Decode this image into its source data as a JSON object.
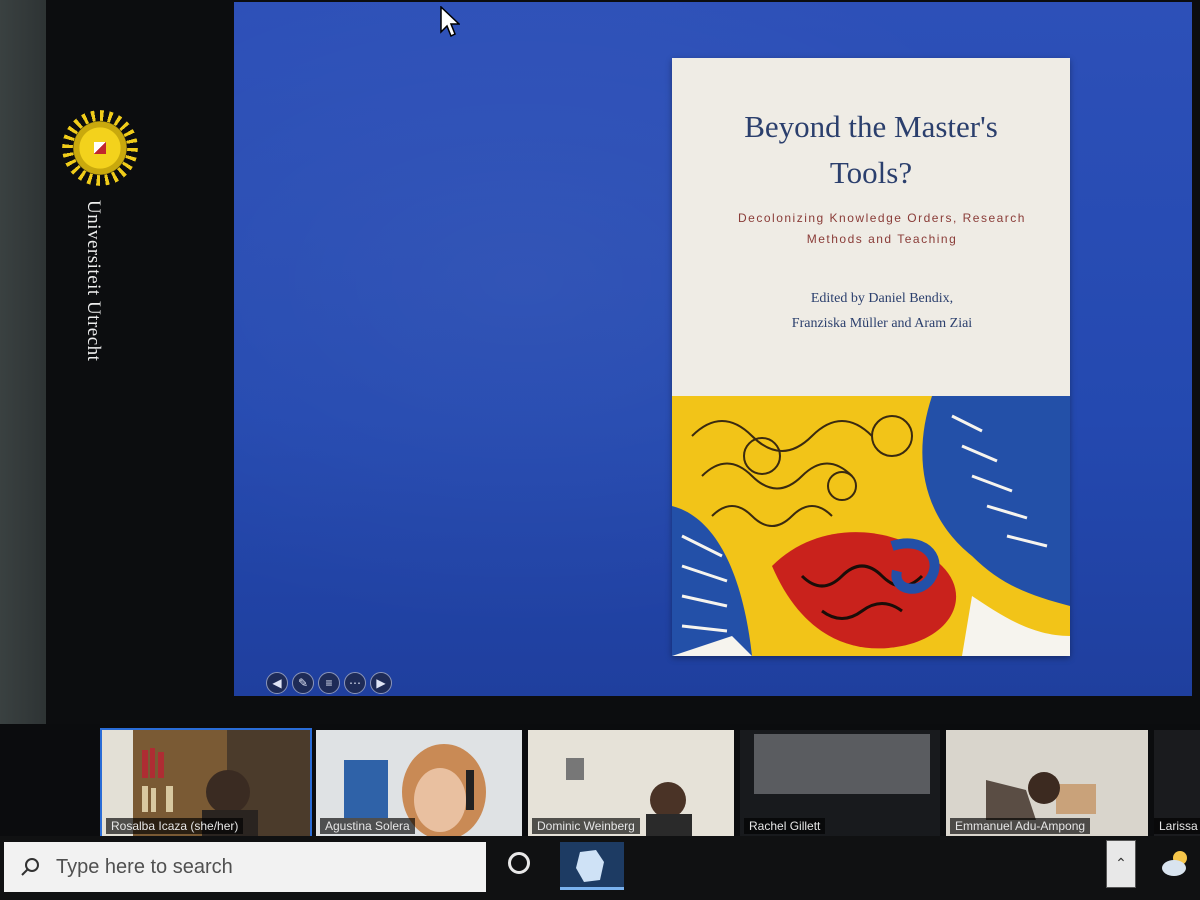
{
  "brand": {
    "university_name": "Universiteit Utrecht",
    "sun_color": "#f3d21c"
  },
  "slide": {
    "background_color": "#2449b0",
    "book": {
      "title": "Beyond the Master's Tools?",
      "subtitle": "Decolonizing Knowledge Orders, Research Methods and Teaching",
      "editors_line1": "Edited by Daniel Bendix,",
      "editors_line2": "Franziska Müller and Aram Ziai",
      "title_color": "#2b3f6d",
      "subtitle_color": "#8a3c38",
      "art_colors": [
        "#f2c418",
        "#2350a8",
        "#c9221c",
        "#f6f4ee"
      ]
    },
    "nav_icons": [
      "arrow-left-icon",
      "pen-icon",
      "menu-icon",
      "more-icon",
      "arrow-right-icon"
    ]
  },
  "participants": [
    {
      "name": "Rosalba Icaza (she/her)",
      "active": true
    },
    {
      "name": "Agustina Solera",
      "active": false
    },
    {
      "name": "Dominic Weinberg",
      "active": false
    },
    {
      "name": "Rachel Gillett",
      "active": false
    },
    {
      "name": "Emmanuel Adu-Ampong",
      "active": false
    },
    {
      "name": "Larissa",
      "active": false
    }
  ],
  "taskbar": {
    "search_placeholder": "Type here to search"
  }
}
